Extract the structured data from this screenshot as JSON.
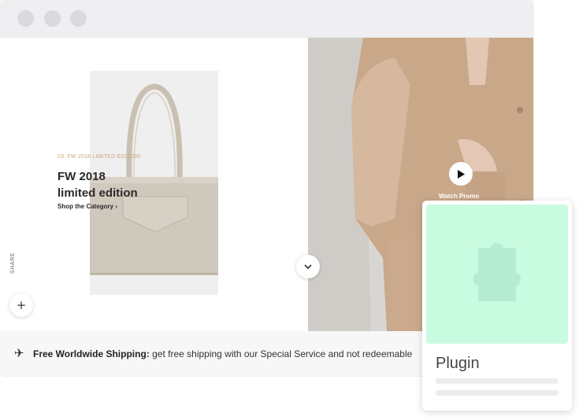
{
  "window": {
    "controls": [
      "close",
      "minimize",
      "maximize"
    ]
  },
  "hero": {
    "eyebrow": "03. FW 2018 LIMITED EDITION",
    "headline_line1": "FW 2018",
    "headline_line2": "limited edition",
    "shop_link": "Shop the Category",
    "shop_chevron": "›",
    "share_label": "SHARE",
    "plus_symbol": "+",
    "scroll_symbol": "⌄",
    "watch_label": "Watch Promo"
  },
  "shipping": {
    "icon": "airplane-icon",
    "bold": "Free Worldwide Shipping:",
    "text": " get free shipping with our Special Service and not redeemable"
  },
  "plugin": {
    "title": "Plugin",
    "icon": "puzzle-piece-icon",
    "accent": "#c9fbe0"
  }
}
